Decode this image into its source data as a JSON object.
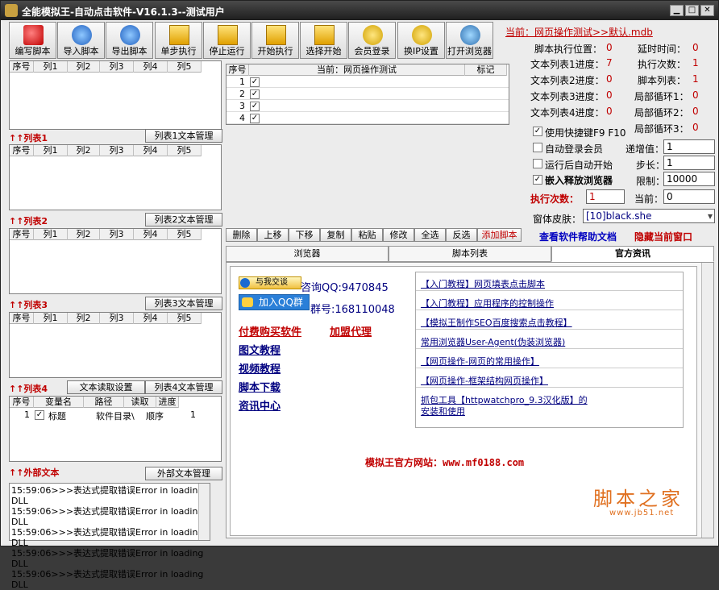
{
  "window": {
    "title": "全能模拟王-自动点击软件-V16.1.3--测试用户",
    "min": "▁",
    "max": "□",
    "close": "✕"
  },
  "toolbar": [
    "编写脚本",
    "导入脚本",
    "导出脚本",
    "单步执行",
    "停止运行",
    "开始执行",
    "选择开始",
    "会员登录",
    "换IP设置",
    "打开浏览器"
  ],
  "lists": {
    "columns": [
      "序号",
      "列1",
      "列2",
      "列3",
      "列4",
      "列5"
    ],
    "labels": [
      "↑↑列表1",
      "↑↑列表2",
      "↑↑列表3",
      "↑↑列表4"
    ],
    "manage": [
      "列表1文本管理",
      "列表2文本管理",
      "列表3文本管理",
      "列表4文本管理"
    ],
    "read_setting": "文本读取设置"
  },
  "varlist": {
    "columns": [
      "序号",
      "变量名",
      "路径",
      "读取",
      "进度"
    ],
    "row": {
      "num": "1",
      "name": "标题",
      "path": "软件目录\\",
      "read": "顺序",
      "progress": "1"
    }
  },
  "external": {
    "label": "↑↑外部文本",
    "manage": "外部文本管理"
  },
  "log": [
    "15:59:06>>>表达式提取错误Error in loading DLL",
    "15:59:06>>>表达式提取错误Error in loading DLL",
    "15:59:06>>>表达式提取错误Error in loading DLL",
    "15:59:06>>>表达式提取错误Error in loading DLL",
    "15:59:06>>>表达式提取错误Error in loading DLL"
  ],
  "script": {
    "columns": [
      "序号",
      "当前：网页操作测试",
      "标记"
    ],
    "rows": [
      "1",
      "2",
      "3",
      "4"
    ]
  },
  "current": {
    "label": "当前：网页操作测试>>默认.mdb"
  },
  "status": {
    "exec_pos": "脚本执行位置：",
    "exec_pos_val": "0",
    "delay": "延时时间：",
    "delay_val": "0",
    "list1": "文本列表1进度：",
    "list1_val": "7",
    "exec_count": "执行次数：",
    "exec_count_val": "1",
    "list2": "文本列表2进度：",
    "list2_val": "0",
    "script_list": "脚本列表：",
    "script_list_val": "1",
    "list3": "文本列表3进度：",
    "list3_val": "0",
    "loop1": "局部循环1：",
    "loop1_val": "0",
    "list4": "文本列表4进度：",
    "list4_val": "0",
    "loop2": "局部循环2：",
    "loop2_val": "0",
    "loop3": "局部循环3：",
    "loop3_val": "0"
  },
  "options": {
    "hotkey": "使用快捷键F9 F10",
    "autologin": "自动登录会员",
    "autostart": "运行后自动开始",
    "embed": "嵌入释放浏览器",
    "increment": "递增值：",
    "increment_val": "1",
    "step": "步长：",
    "step_val": "1",
    "limit": "限制：",
    "limit_val": "10000",
    "exec_times": "执行次数：",
    "exec_times_val": "1",
    "current": "当前：",
    "current_val": "0",
    "skin": "窗体皮肤：",
    "skin_val": "[10]black.she"
  },
  "actions": [
    "删除",
    "上移",
    "下移",
    "复制",
    "粘贴",
    "修改",
    "全选",
    "反选",
    "添加脚本"
  ],
  "help_link": "查看软件帮助文档",
  "hide_link": "隐藏当前窗口",
  "tabs": [
    "浏览器",
    "脚本列表",
    "官方资讯"
  ],
  "news": {
    "qq_talk": "与我交谈",
    "consult": "咨询QQ:9470845",
    "join_group": "加入QQ群",
    "group": "群号:168110048",
    "buy": "付费购买软件",
    "agent": "加盟代理",
    "links": [
      "图文教程",
      "视频教程",
      "脚本下载",
      "资讯中心"
    ],
    "articles": [
      "【入门教程】网页填表点击脚本",
      "【入门教程】应用程序的控制操作",
      "【模拟王制作SEO百度搜索点击教程】",
      "常用浏览器User-Agent(伪装浏览器)",
      "【网页操作-网页的常用操作】",
      "【网页操作-框架结构网页操作】",
      "抓包工具【httpwatchpro_9.3汉化版】的",
      "安装和使用"
    ],
    "site": "模拟王官方网站：www.mf0188.com",
    "watermark": "脚本之家",
    "watermark_url": "www.jb51.net"
  }
}
